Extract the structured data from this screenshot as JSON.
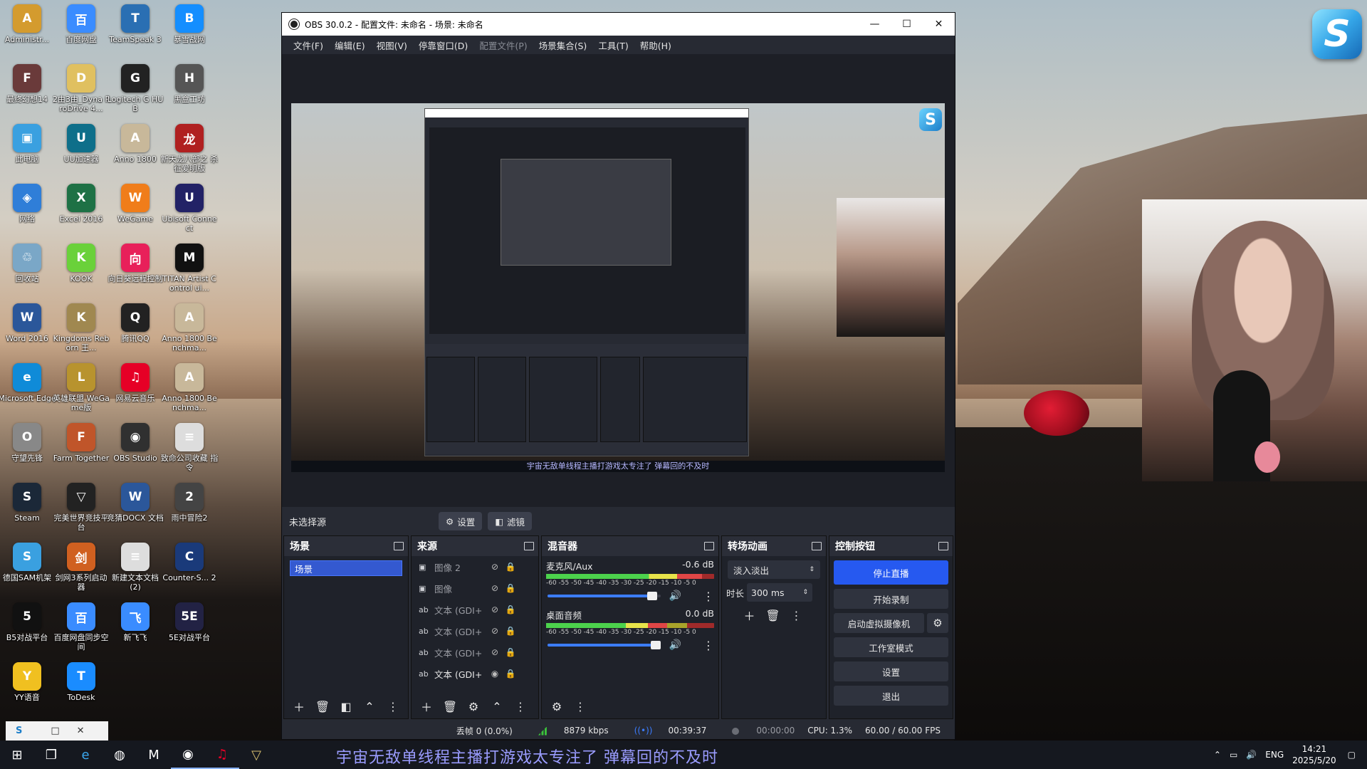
{
  "desktop": {
    "icons": [
      {
        "label": "Administr...",
        "glyph": "A",
        "color": "#d49b2e"
      },
      {
        "label": "百度网盘",
        "glyph": "百",
        "color": "#3a8cff"
      },
      {
        "label": "TeamSpeak 3",
        "glyph": "T",
        "color": "#2a6fb3"
      },
      {
        "label": "暴雪战网",
        "glyph": "B",
        "color": "#148eff"
      },
      {
        "label": "最终幻想14",
        "glyph": "F",
        "color": "#6a3a3a"
      },
      {
        "label": "2由3由_Dyna ProDrive 4...",
        "glyph": "D",
        "color": "#e0c060"
      },
      {
        "label": "Logitech G HUB",
        "glyph": "G",
        "color": "#222222"
      },
      {
        "label": "黑盒工坊",
        "glyph": "H",
        "color": "#555555"
      },
      {
        "label": "此电脑",
        "glyph": "▣",
        "color": "#3aa0e0"
      },
      {
        "label": "UU加速器",
        "glyph": "U",
        "color": "#0e6f8a"
      },
      {
        "label": "Anno 1800",
        "glyph": "A",
        "color": "#c8b89a"
      },
      {
        "label": "新天龙八部之 杀征爱明版",
        "glyph": "龙",
        "color": "#b02020"
      },
      {
        "label": "网络",
        "glyph": "◈",
        "color": "#2f7ed8"
      },
      {
        "label": "Excel 2016",
        "glyph": "X",
        "color": "#1e7145"
      },
      {
        "label": "WeGame",
        "glyph": "W",
        "color": "#f07d1a"
      },
      {
        "label": "Ubisoft Connect",
        "glyph": "U",
        "color": "#222266"
      },
      {
        "label": "回收站",
        "glyph": "♲",
        "color": "#7aa7c7"
      },
      {
        "label": "KOOK",
        "glyph": "K",
        "color": "#6ad13a"
      },
      {
        "label": "向日葵远程控制",
        "glyph": "向",
        "color": "#e8205a"
      },
      {
        "label": "TITAN Artist Control ui...",
        "glyph": "M",
        "color": "#111111"
      },
      {
        "label": "Word 2016",
        "glyph": "W",
        "color": "#2b579a"
      },
      {
        "label": "Kingdoms Reborn 王...",
        "glyph": "K",
        "color": "#a08850"
      },
      {
        "label": "腾讯QQ",
        "glyph": "Q",
        "color": "#222222"
      },
      {
        "label": "Anno 1800 Benchma...",
        "glyph": "A",
        "color": "#c8b89a"
      },
      {
        "label": "Microsoft Edge",
        "glyph": "e",
        "color": "#0f8bd8"
      },
      {
        "label": "英雄联盟 WeGame版",
        "glyph": "L",
        "color": "#b8932e"
      },
      {
        "label": "网易云音乐",
        "glyph": "♫",
        "color": "#e60026"
      },
      {
        "label": "Anno 1800 Benchma...",
        "glyph": "A",
        "color": "#c8b89a"
      },
      {
        "label": "守望先锋",
        "glyph": "O",
        "color": "#888888"
      },
      {
        "label": "Farm Together",
        "glyph": "F",
        "color": "#c0552a"
      },
      {
        "label": "OBS Studio",
        "glyph": "◉",
        "color": "#303030"
      },
      {
        "label": "致命公司收藏 指令",
        "glyph": "≡",
        "color": "#dddddd"
      },
      {
        "label": "Steam",
        "glyph": "S",
        "color": "#1b2838"
      },
      {
        "label": "完美世界竞技平台",
        "glyph": "▽",
        "color": "#222222"
      },
      {
        "label": "竞猜DOCX 文档",
        "glyph": "W",
        "color": "#2b579a"
      },
      {
        "label": "雨中冒险2",
        "glyph": "2",
        "color": "#444444"
      },
      {
        "label": "德国SAM机架",
        "glyph": "S",
        "color": "#3aa0e0"
      },
      {
        "label": "剑网3系列启动器",
        "glyph": "剑",
        "color": "#d06020"
      },
      {
        "label": "新建文本文档 (2)",
        "glyph": "≡",
        "color": "#dddddd"
      },
      {
        "label": "Counter-S... 2",
        "glyph": "C",
        "color": "#1a3a7a"
      },
      {
        "label": "B5对战平台",
        "glyph": "5",
        "color": "#111111"
      },
      {
        "label": "百度网盘同步空间",
        "glyph": "百",
        "color": "#3a8cff"
      },
      {
        "label": "新飞飞",
        "glyph": "飞",
        "color": "#3a8cff"
      },
      {
        "label": "5E对战平台",
        "glyph": "5E",
        "color": "#222244"
      },
      {
        "label": "YY语音",
        "glyph": "Y",
        "color": "#f0c020"
      },
      {
        "label": "ToDesk",
        "glyph": "T",
        "color": "#1a8cff"
      }
    ],
    "sticker_letter": "S",
    "mini_window_controls": [
      "□",
      "✕"
    ]
  },
  "obs": {
    "title": "OBS 30.0.2 - 配置文件: 未命名 - 场景: 未命名",
    "window_buttons": {
      "minimize": "—",
      "maximize": "☐",
      "close": "✕"
    },
    "menu": [
      {
        "label": "文件(F)",
        "enabled": true
      },
      {
        "label": "编辑(E)",
        "enabled": true
      },
      {
        "label": "视图(V)",
        "enabled": true
      },
      {
        "label": "停靠窗口(D)",
        "enabled": true
      },
      {
        "label": "配置文件(P)",
        "enabled": false
      },
      {
        "label": "场景集合(S)",
        "enabled": true
      },
      {
        "label": "工具(T)",
        "enabled": true
      },
      {
        "label": "帮助(H)",
        "enabled": true
      }
    ],
    "preview": {
      "subtitle": "宇宙无敌单线程主播打游戏太专注了 弹幕回的不及时"
    },
    "source_bar": {
      "no_source": "未选择源",
      "settings": "设置",
      "filters": "滤镜"
    },
    "scenes": {
      "title": "场景",
      "items": [
        "场景"
      ]
    },
    "sources": {
      "title": "来源",
      "items": [
        {
          "type": "img",
          "name": "图像 2",
          "visible": false
        },
        {
          "type": "img",
          "name": "图像",
          "visible": false
        },
        {
          "type": "ab",
          "name": "文本 (GDI+",
          "visible": false
        },
        {
          "type": "ab",
          "name": "文本 (GDI+",
          "visible": false
        },
        {
          "type": "ab",
          "name": "文本 (GDI+",
          "visible": false
        },
        {
          "type": "ab",
          "name": "文本 (GDI+",
          "visible": true
        }
      ]
    },
    "mixer": {
      "title": "混音器",
      "ticks": "-60 -55 -50 -45 -40 -35 -30 -25 -20 -15 -10 -5 0",
      "channels": [
        {
          "name": "麦克风/Aux",
          "db": "-0.6 dB",
          "level": 0.93,
          "volume": 0.97
        },
        {
          "name": "桌面音频",
          "db": "0.0 dB",
          "level": 0.72,
          "volume": 1.0
        }
      ]
    },
    "transitions": {
      "title": "转场动画",
      "selected": "淡入淡出",
      "duration_label": "时长",
      "duration_value": "300 ms"
    },
    "controls": {
      "title": "控制按钮",
      "stop_stream": "停止直播",
      "start_record": "开始录制",
      "virtual_cam": "启动虚拟摄像机",
      "studio_mode": "工作室模式",
      "settings": "设置",
      "exit": "退出"
    },
    "status": {
      "dropped": "丢帧 0 (0.0%)",
      "bitrate": "8879 kbps",
      "live_time": "00:39:37",
      "rec_time": "00:00:00",
      "cpu": "CPU: 1.3%",
      "fps": "60.00 / 60.00 FPS"
    }
  },
  "taskbar": {
    "subtitle": "宇宙无敌单线程主播打游戏太专注了 弹幕回的不及时",
    "lang": "ENG",
    "time": "14:21",
    "date": "2025/5/20"
  },
  "colors": {
    "accent": "#2659f0",
    "panel": "#1f222a",
    "header": "#2b2e38"
  }
}
